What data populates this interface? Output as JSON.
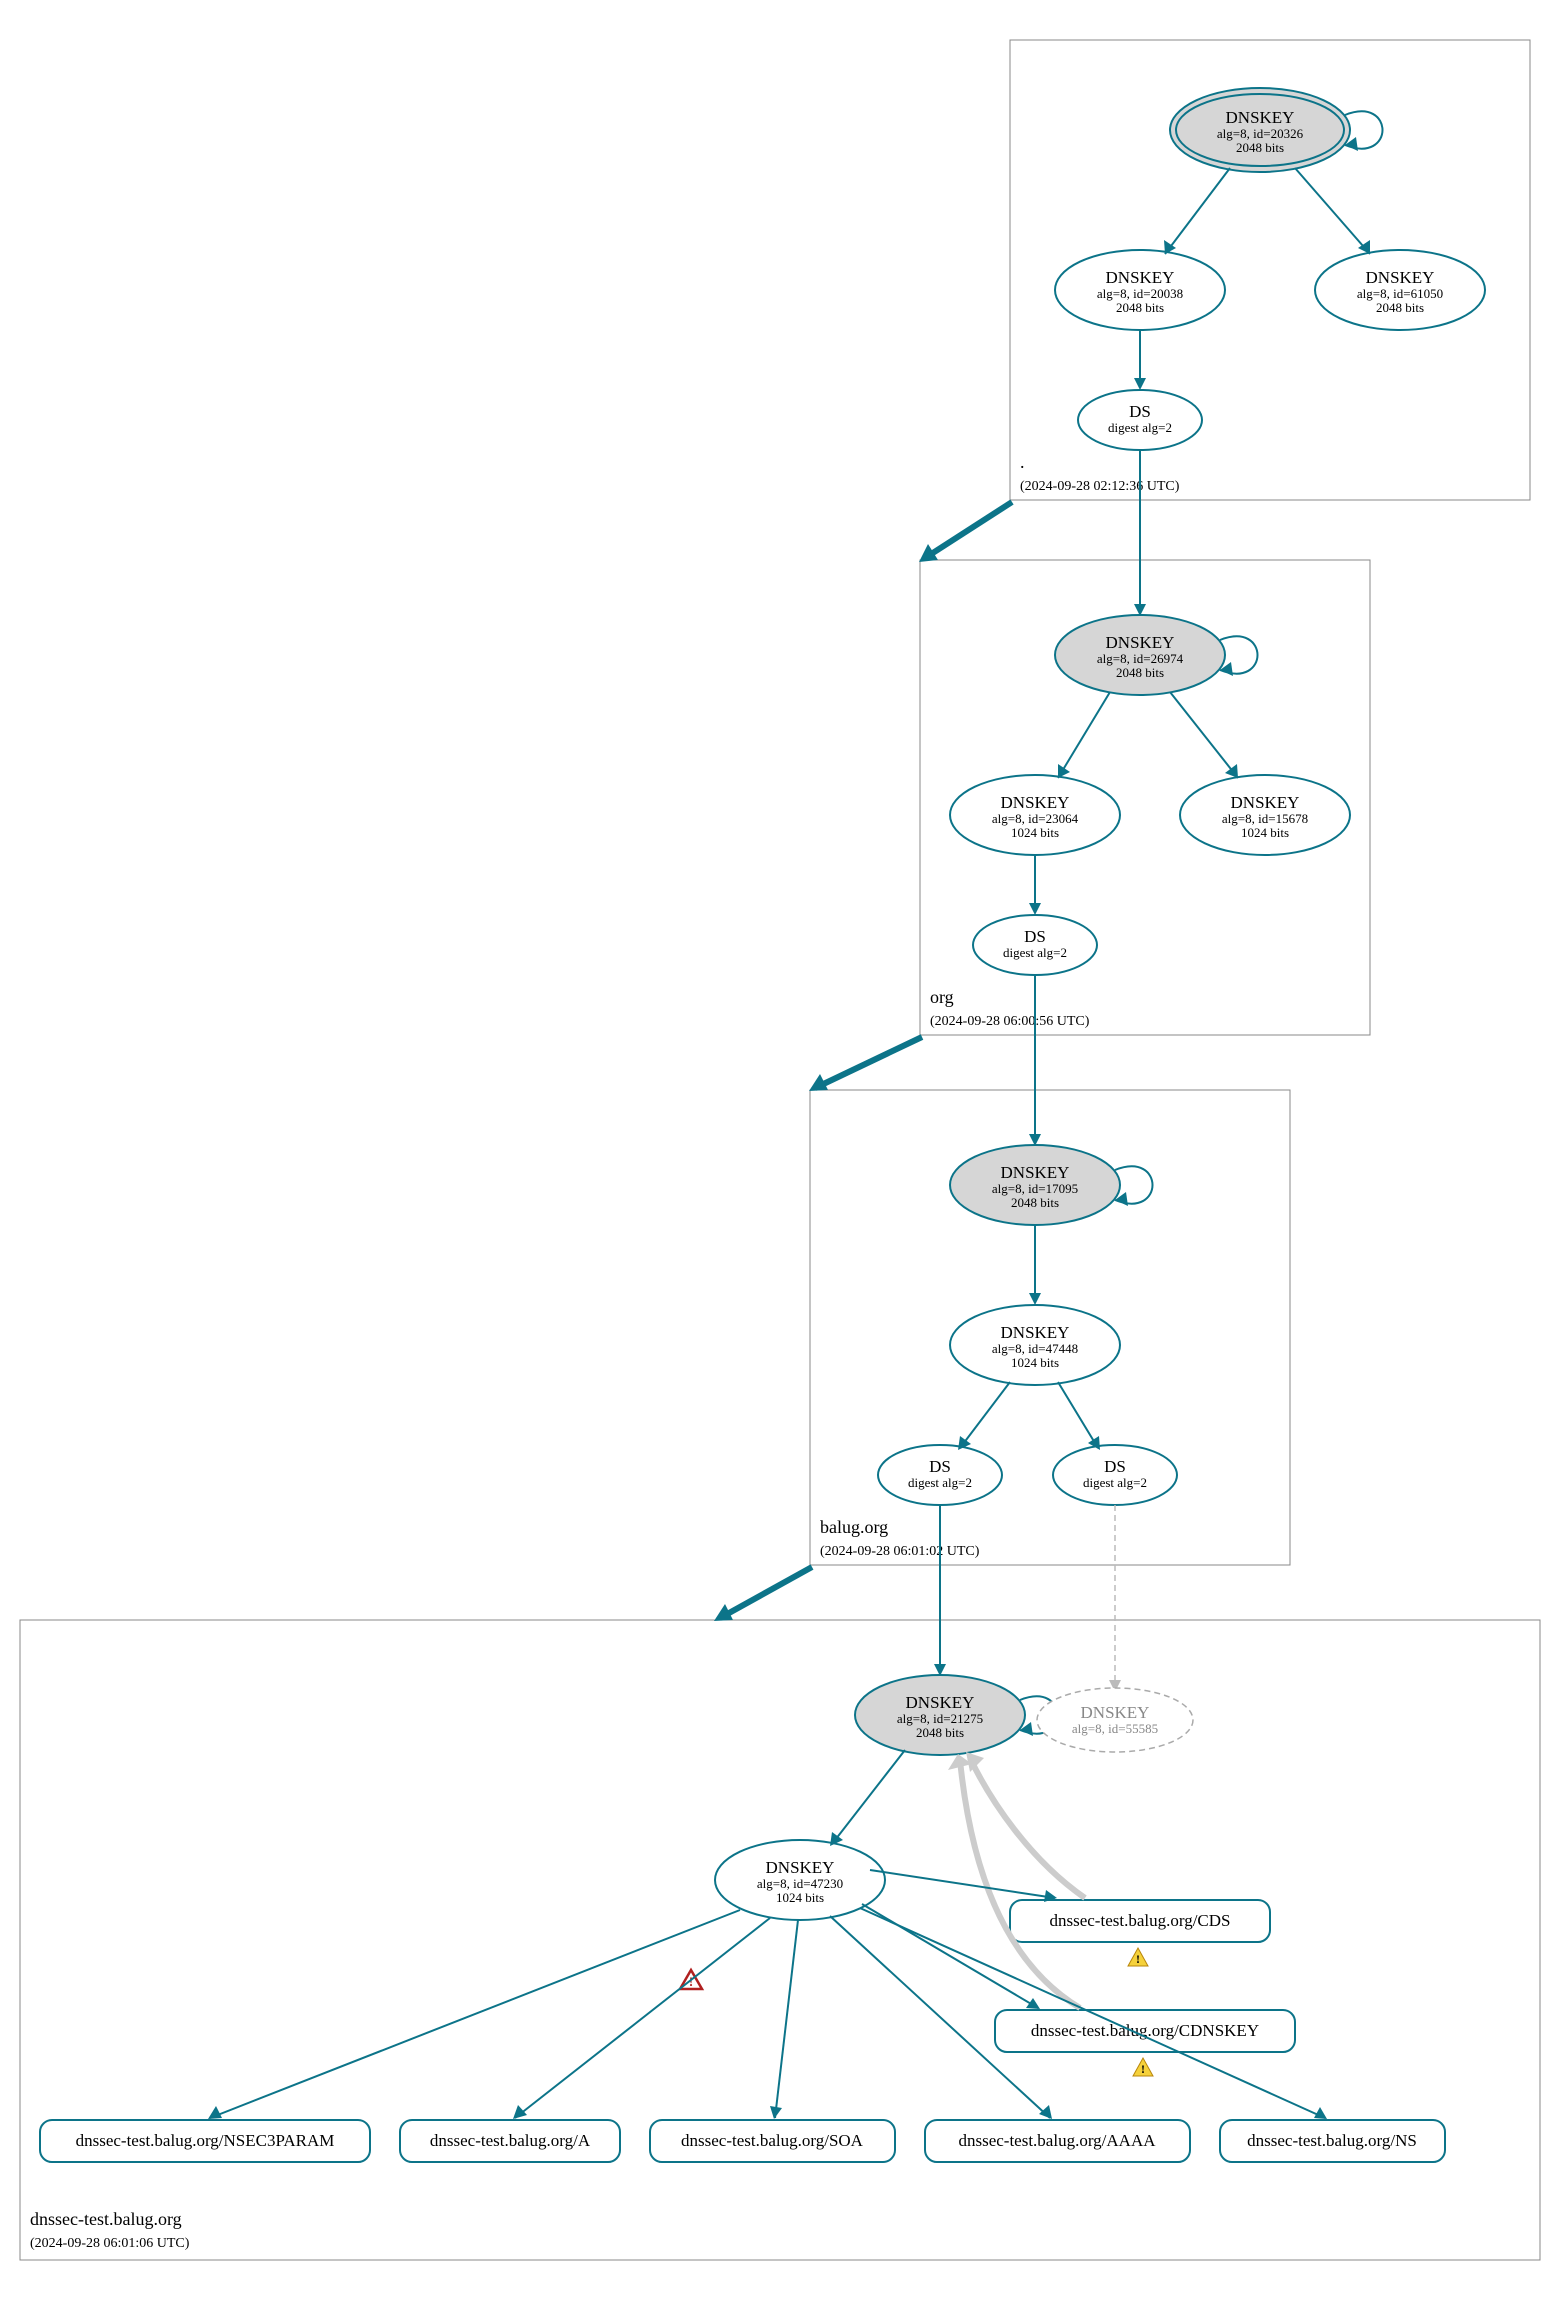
{
  "colors": {
    "edge": "#0c7489",
    "ksk_fill": "#d6d6d6",
    "box_stroke": "#888888"
  },
  "zones": {
    "root": {
      "name": ".",
      "timestamp": "(2024-09-28 02:12:36 UTC)"
    },
    "org": {
      "name": "org",
      "timestamp": "(2024-09-28 06:00:56 UTC)"
    },
    "balug": {
      "name": "balug.org",
      "timestamp": "(2024-09-28 06:01:02 UTC)"
    },
    "dnssectest": {
      "name": "dnssec-test.balug.org",
      "timestamp": "(2024-09-28 06:01:06 UTC)"
    }
  },
  "nodes": {
    "root_ksk": {
      "title": "DNSKEY",
      "line1": "alg=8, id=20326",
      "line2": "2048 bits"
    },
    "root_zsk1": {
      "title": "DNSKEY",
      "line1": "alg=8, id=20038",
      "line2": "2048 bits"
    },
    "root_zsk2": {
      "title": "DNSKEY",
      "line1": "alg=8, id=61050",
      "line2": "2048 bits"
    },
    "root_ds": {
      "title": "DS",
      "line1": "digest alg=2"
    },
    "org_ksk": {
      "title": "DNSKEY",
      "line1": "alg=8, id=26974",
      "line2": "2048 bits"
    },
    "org_zsk1": {
      "title": "DNSKEY",
      "line1": "alg=8, id=23064",
      "line2": "1024 bits"
    },
    "org_zsk2": {
      "title": "DNSKEY",
      "line1": "alg=8, id=15678",
      "line2": "1024 bits"
    },
    "org_ds": {
      "title": "DS",
      "line1": "digest alg=2"
    },
    "balug_ksk": {
      "title": "DNSKEY",
      "line1": "alg=8, id=17095",
      "line2": "2048 bits"
    },
    "balug_zsk": {
      "title": "DNSKEY",
      "line1": "alg=8, id=47448",
      "line2": "1024 bits"
    },
    "balug_ds1": {
      "title": "DS",
      "line1": "digest alg=2"
    },
    "balug_ds2": {
      "title": "DS",
      "line1": "digest alg=2"
    },
    "dt_ksk": {
      "title": "DNSKEY",
      "line1": "alg=8, id=21275",
      "line2": "2048 bits"
    },
    "dt_ksk_dashed": {
      "title": "DNSKEY",
      "line1": "alg=8, id=55585"
    },
    "dt_zsk": {
      "title": "DNSKEY",
      "line1": "alg=8, id=47230",
      "line2": "1024 bits"
    }
  },
  "records": {
    "nsec3param": "dnssec-test.balug.org/NSEC3PARAM",
    "a": "dnssec-test.balug.org/A",
    "soa": "dnssec-test.balug.org/SOA",
    "aaaa": "dnssec-test.balug.org/AAAA",
    "ns": "dnssec-test.balug.org/NS",
    "cds": "dnssec-test.balug.org/CDS",
    "cdnskey": "dnssec-test.balug.org/CDNSKEY"
  },
  "icons": {
    "warn_yellow": "warning-icon",
    "warn_red": "error-icon"
  }
}
